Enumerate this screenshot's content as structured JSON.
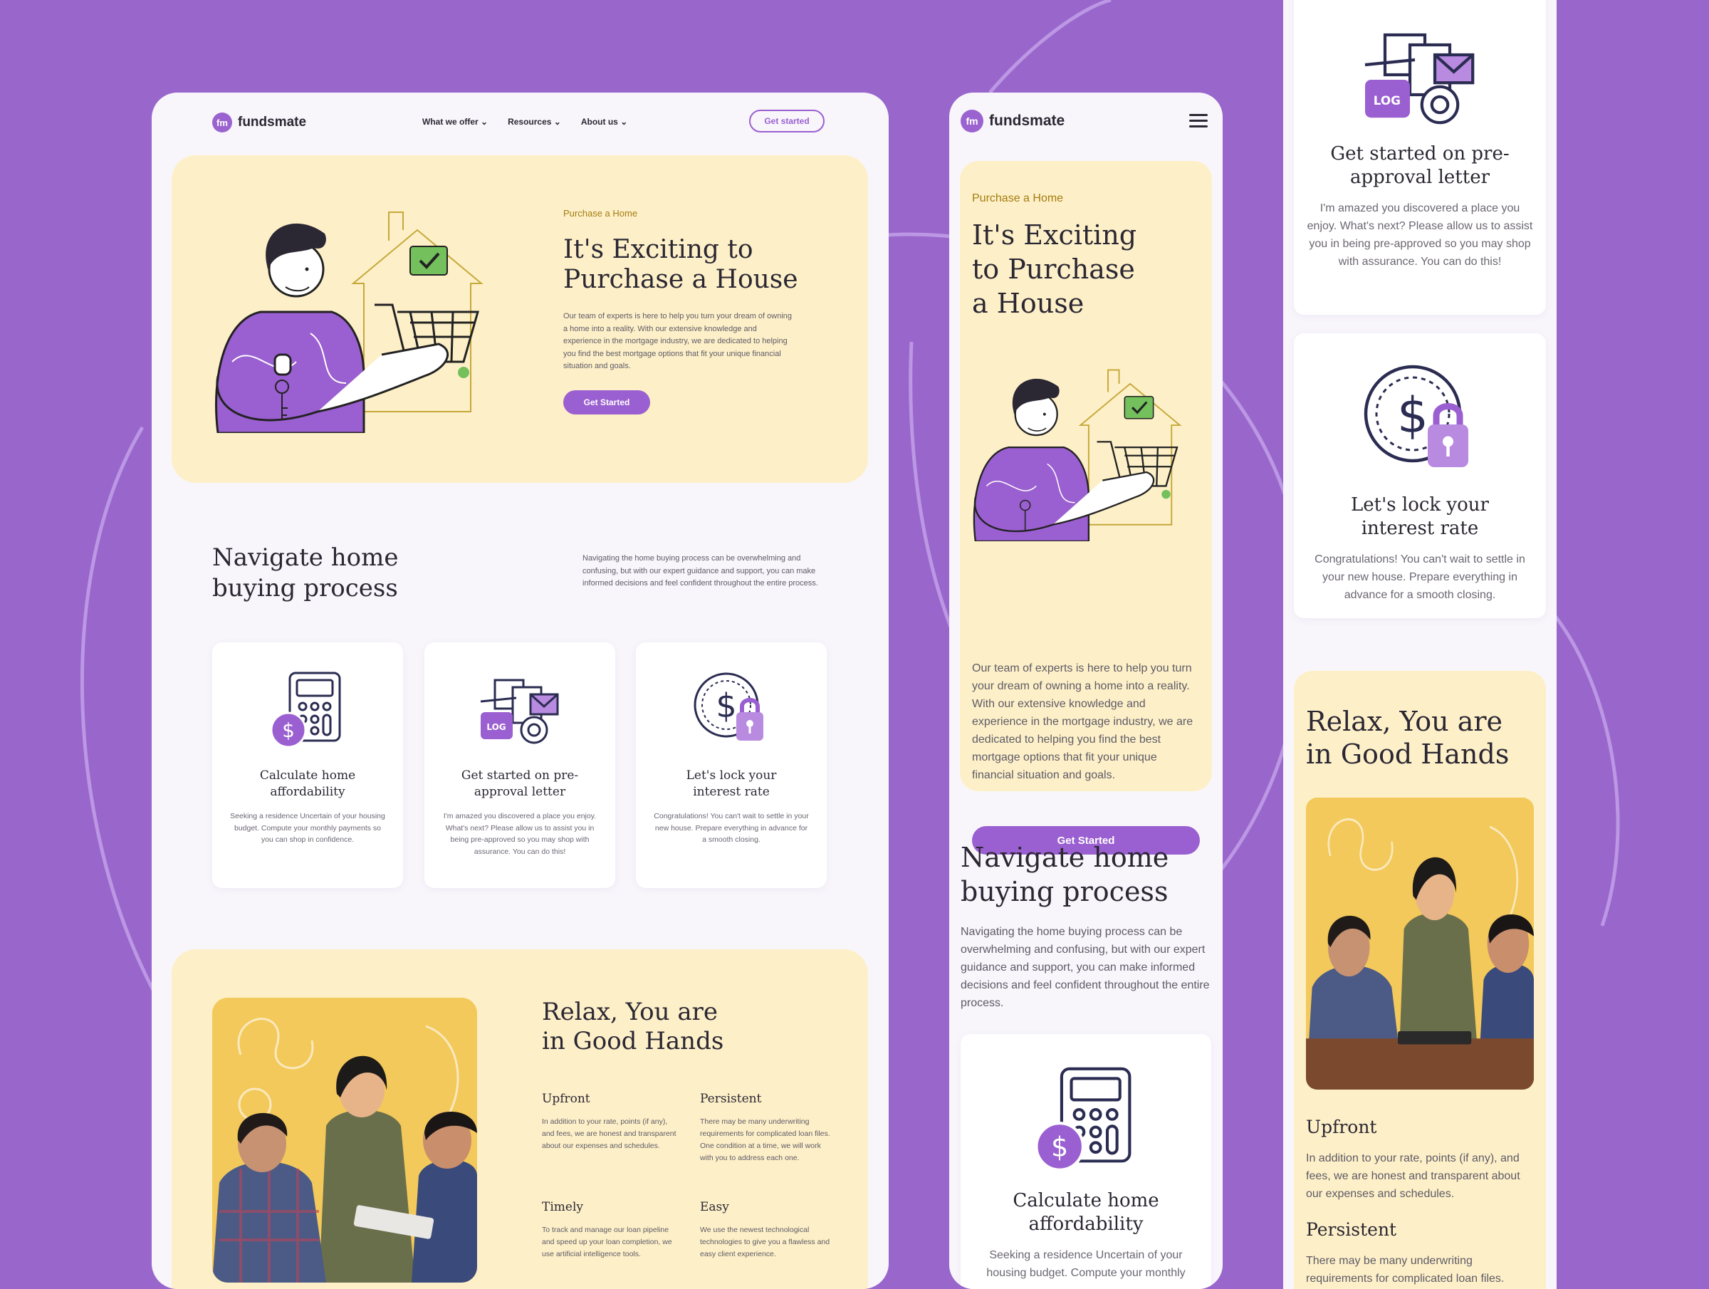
{
  "brand": {
    "name": "fundsmate",
    "mark": "fm"
  },
  "colors": {
    "background": "#9966cc",
    "accent": "#9a5fd0",
    "cream": "#fdf0c8",
    "eyebrow": "#a47b10"
  },
  "desktop": {
    "nav": {
      "items": [
        "What we offer",
        "Resources",
        "About us"
      ],
      "cta": "Get started"
    },
    "hero": {
      "eyebrow": "Purchase a Home",
      "title": "It's Exciting to Purchase a House",
      "body": "Our team of experts is here to help you turn your dream of owning a home into a reality. With our extensive knowledge and experience in the mortgage industry, we are dedicated to helping you find the best mortgage options that fit your unique financial situation and goals.",
      "cta": "Get Started"
    },
    "navigate": {
      "title": "Navigate home buying process",
      "body": "Navigating the home buying process can be overwhelming and confusing, but with our expert guidance and support, you can make informed decisions and feel confident throughout the entire process."
    },
    "cards": [
      {
        "title": "Calculate home affordability",
        "body": "Seeking a residence Uncertain of your housing budget. Compute your monthly payments so you can shop in confidence.",
        "icon": "calculator-icon"
      },
      {
        "title": "Get started on pre-approval letter",
        "body": "I'm amazed you discovered a place you enjoy. What's next? Please allow us to assist you in being pre-approved so you may shop with assurance. You can do this!",
        "icon": "documents-icon"
      },
      {
        "title": "Let's lock your interest rate",
        "body": "Congratulations! You can't wait to settle in your new house. Prepare everything in advance for a smooth closing.",
        "icon": "dollar-lock-icon"
      }
    ],
    "relax": {
      "title": "Relax, You are in Good Hands",
      "features": [
        {
          "title": "Upfront",
          "body": "In addition to your rate, points (if any), and fees, we are honest and transparent about our expenses and schedules."
        },
        {
          "title": "Persistent",
          "body": "There may be many underwriting requirements for complicated loan files. One condition at a time, we will work with you to address each one."
        },
        {
          "title": "Timely",
          "body": "To track and manage our loan pipeline and speed up your loan completion, we use artificial intelligence tools."
        },
        {
          "title": "Easy",
          "body": "We use the newest technological technologies to give you a flawless and easy client experience."
        }
      ]
    }
  },
  "mobile": {
    "hero": {
      "eyebrow": "Purchase a Home",
      "title": "It's Exciting to Purchase a House",
      "body": "Our team of experts is here to help you turn your dream of owning a home into a reality. With our extensive knowledge and experience in the mortgage industry, we are dedicated to helping you find the best mortgage options that fit your unique financial situation and goals.",
      "cta": "Get Started"
    },
    "navigate": {
      "title": "Navigate home buying process",
      "body": "Navigating the home buying process can be overwhelming and confusing, but with our expert guidance and support, you can make informed decisions and feel confident throughout the entire process."
    },
    "card": {
      "title": "Calculate home affordability",
      "body": "Seeking a residence Uncertain of your housing budget. Compute your monthly"
    }
  },
  "mobile2": {
    "cards": [
      {
        "title": "Get started on pre-approval letter",
        "body": "I'm amazed you discovered a place you enjoy. What's next? Please allow us to assist you in being pre-approved so you may shop with assurance. You can do this!"
      },
      {
        "title": "Let's lock your interest rate",
        "body": "Congratulations! You can't wait to settle in your new house. Prepare everything in advance for a smooth closing."
      }
    ],
    "relax": {
      "title": "Relax, You are in Good Hands",
      "features": [
        {
          "title": "Upfront",
          "body": "In addition to your rate, points (if any), and fees, we are honest and transparent about our expenses and schedules."
        },
        {
          "title": "Persistent",
          "body": "There may be many underwriting requirements for complicated loan files."
        }
      ]
    }
  }
}
